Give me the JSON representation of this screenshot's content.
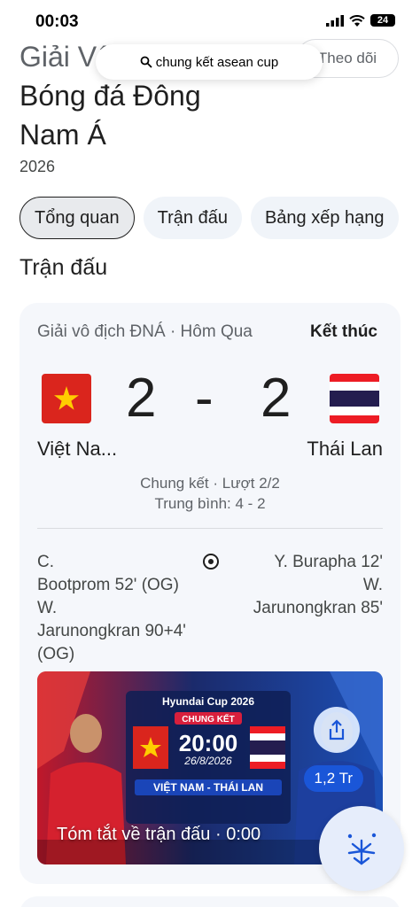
{
  "status_bar": {
    "time": "00:03",
    "battery": "24"
  },
  "search": {
    "query": "chung kết asean cup"
  },
  "header": {
    "title_line1": "Giải Vô địch",
    "title_line2": "Bóng đá Đông",
    "title_line3": "Nam Á",
    "follow_label": "Theo dõi",
    "year": "2026"
  },
  "tabs": [
    {
      "label": "Tổng quan",
      "active": true
    },
    {
      "label": "Trận đấu",
      "active": false
    },
    {
      "label": "Bảng xếp hạng",
      "active": false
    }
  ],
  "section_title": "Trận đấu",
  "match": {
    "competition": "Giải vô địch ĐNÁ · Hôm Qua",
    "status": "Kết thúc",
    "home": {
      "name": "Việt Na...",
      "score": "2",
      "flag": "vietnam-flag-icon"
    },
    "away": {
      "name": "Thái Lan",
      "score": "2",
      "flag": "thailand-flag-icon"
    },
    "separator": "-",
    "round": "Chung kết · Lượt 2/2",
    "aggregate": "Trung bình: 4 - 2",
    "home_scorers": [
      "C.",
      "Bootprom 52' (OG)",
      "W.",
      "Jarunongkran 90+4' (OG)"
    ],
    "away_scorers": [
      "Y. Burapha 12'",
      "W.",
      "Jarunongkran 85'"
    ]
  },
  "video": {
    "caption": "Tóm tắt về trận đấu",
    "duration": "0:00",
    "views": "1,2 Tr",
    "poster": {
      "brand": "Hyundai Cup 2026",
      "stage": "CHUNG KẾT",
      "kickoff": "20:00",
      "date": "26/8/2026",
      "matchup": "VIỆT NAM - THÁI LAN"
    }
  },
  "colors": {
    "accent_blue": "#1a56d8",
    "card_bg": "#f5f7fb",
    "vn_red": "#da251d",
    "vn_star": "#ffcd00",
    "th_red": "#ed1c24",
    "th_blue": "#241d4f"
  }
}
